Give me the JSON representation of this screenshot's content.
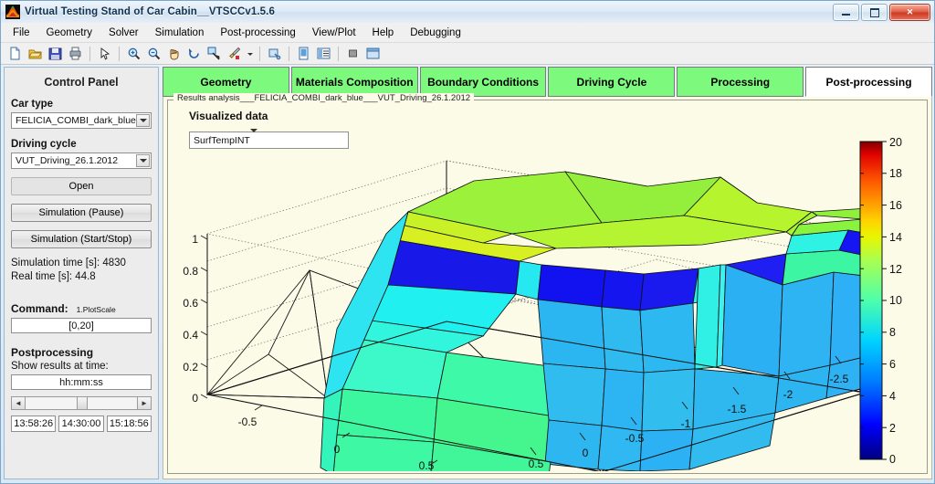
{
  "window": {
    "title": "Virtual Testing Stand of Car Cabin__VTSCCv1.5.6",
    "icon": "matlab-membrane-icon",
    "buttons": {
      "minimize": "minimize-icon",
      "maximize": "maximize-icon",
      "close": "✕"
    }
  },
  "menu": {
    "items": [
      {
        "label": "File"
      },
      {
        "label": "Geometry"
      },
      {
        "label": "Solver"
      },
      {
        "label": "Simulation"
      },
      {
        "label": "Post-processing"
      },
      {
        "label": "View/Plot"
      },
      {
        "label": "Help"
      },
      {
        "label": "Debugging"
      }
    ]
  },
  "toolbar": {
    "items": [
      {
        "name": "new-figure-icon"
      },
      {
        "name": "open-file-icon"
      },
      {
        "name": "save-figure-icon"
      },
      {
        "name": "print-figure-icon"
      },
      {
        "name": "pointer-select-icon"
      },
      {
        "name": "zoom-in-icon"
      },
      {
        "name": "zoom-out-icon"
      },
      {
        "name": "pan-hand-icon"
      },
      {
        "name": "rotate-3d-icon"
      },
      {
        "name": "data-cursor-icon"
      },
      {
        "name": "brush-icon"
      },
      {
        "name": "brush-color-dropdown-icon"
      },
      {
        "name": "link-plot-icon"
      },
      {
        "name": "figure-palette-icon"
      },
      {
        "name": "plot-browser-icon"
      },
      {
        "name": "property-editor-icon"
      },
      {
        "name": "dock-figure-icon"
      }
    ]
  },
  "control_panel": {
    "title": "Control Panel",
    "car_type": {
      "label": "Car type",
      "value": "FELICIA_COMBI_dark_blue"
    },
    "driving_cycle": {
      "label": "Driving cycle",
      "value": "VUT_Driving_26.1.2012"
    },
    "open_button": "Open",
    "pause_button": "Simulation (Pause)",
    "start_stop_button": "Simulation (Start/Stop)",
    "simulation_time": "Simulation time [s]: 4830",
    "real_time": "Real time [s]: 44.8",
    "command_label": "Command:",
    "command_name": "1.PlotScale",
    "command_value": "[0,20]",
    "postprocessing_title": "Postprocessing",
    "show_results_label": "Show results at time:",
    "time_value": "hh:mm:ss",
    "time_start": "13:58:26",
    "time_current": "14:30:00",
    "time_end": "15:18:56",
    "slider_left": "◄",
    "slider_right": "►"
  },
  "tabs": [
    {
      "label": "Geometry",
      "active": false
    },
    {
      "label": "Materials Composition",
      "active": false
    },
    {
      "label": "Boundary Conditions",
      "active": false
    },
    {
      "label": "Driving Cycle",
      "active": false
    },
    {
      "label": "Processing",
      "active": false
    },
    {
      "label": "Post-processing",
      "active": true
    }
  ],
  "results_panel": {
    "legend": "Results analysis___FELICIA_COMBI_dark_blue___VUT_Driving_26.1.2012",
    "visualized_data_label": "Visualized data",
    "visualized_data_value": "SurfTempINT"
  },
  "colors": {
    "tab_inactive": "#7dfa7d",
    "tab_active": "#ffffff",
    "plot_background": "#fbfbe8",
    "panel_background": "#ececec"
  },
  "chart_data": {
    "type": "surface3d",
    "title": "",
    "colormap": "jet",
    "colorbar": {
      "label": "",
      "min": 0,
      "max": 20,
      "ticks": [
        0,
        2,
        4,
        6,
        8,
        10,
        12,
        14,
        16,
        18,
        20
      ],
      "tick_labels": [
        "0",
        "2",
        "4",
        "6",
        "8",
        "10",
        "12",
        "14",
        "16",
        "18",
        "20"
      ],
      "position": "right"
    },
    "axes": {
      "x": {
        "label": "",
        "ticks": [
          -0.5,
          0,
          0.5
        ],
        "tick_labels": [
          "-0.5",
          "0",
          "0.5"
        ]
      },
      "y": {
        "label": "",
        "ticks": [
          0.5,
          0,
          -0.5,
          -1,
          -1.5,
          -2,
          -2.5
        ],
        "tick_labels": [
          "0.5",
          "0",
          "-0.5",
          "-1",
          "-1.5",
          "-2",
          "-2.5"
        ]
      },
      "z": {
        "label": "",
        "ticks": [
          0,
          0.2,
          0.4,
          0.6,
          0.8,
          1
        ],
        "tick_labels": [
          "0",
          "0.2",
          "0.4",
          "0.6",
          "0.8",
          "1"
        ]
      }
    },
    "grid": true,
    "legend": "none",
    "description": "Triangulated surface mesh of a car cabin interior coloured by interior surface temperature (SurfTempINT), jet colormap scaled 0-20."
  }
}
